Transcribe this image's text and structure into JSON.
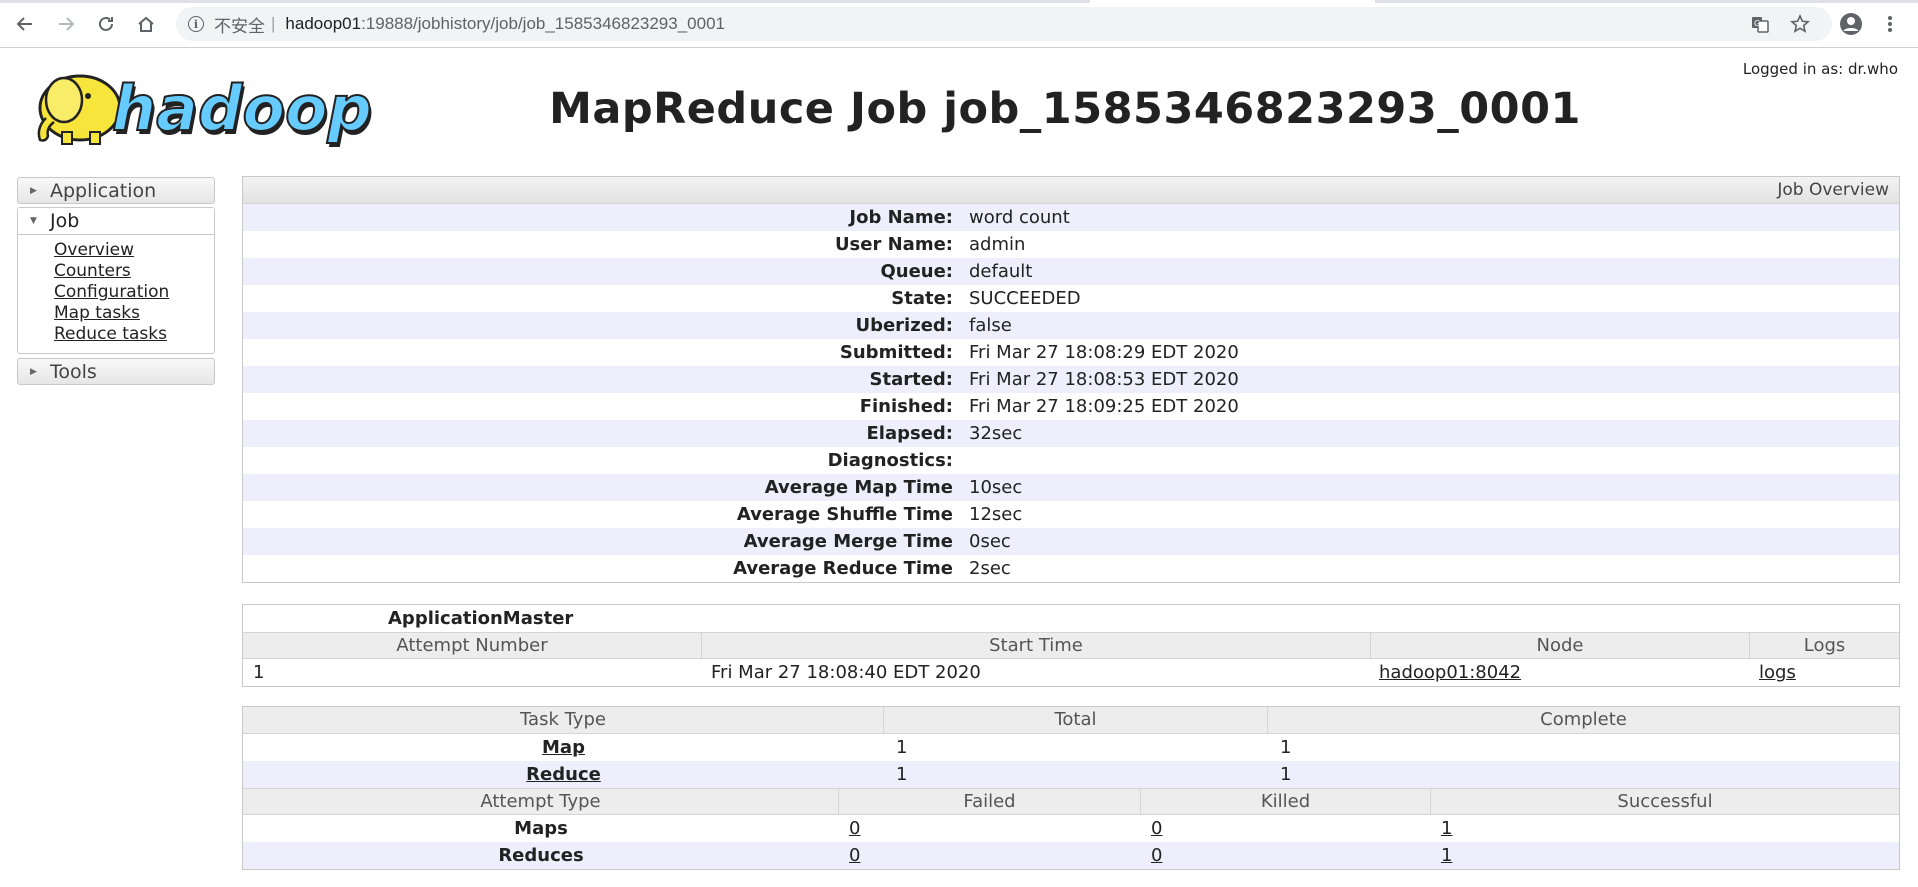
{
  "browser": {
    "insecure_label": "不安全",
    "url_host": "hadoop01",
    "url_path": ":19888/jobhistory/job/job_1585346823293_0001"
  },
  "header": {
    "logged_in": "Logged in as: dr.who",
    "title": "MapReduce Job job_1585346823293_0001",
    "logo_text": "hadoop"
  },
  "nav": {
    "application": "Application",
    "job": "Job",
    "job_items": [
      "Overview",
      "Counters",
      "Configuration",
      "Map tasks",
      "Reduce tasks"
    ],
    "tools": "Tools"
  },
  "overview": {
    "header": "Job Overview",
    "rows": [
      {
        "key": "Job Name:",
        "value": "word count"
      },
      {
        "key": "User Name:",
        "value": "admin"
      },
      {
        "key": "Queue:",
        "value": "default"
      },
      {
        "key": "State:",
        "value": "SUCCEEDED"
      },
      {
        "key": "Uberized:",
        "value": "false"
      },
      {
        "key": "Submitted:",
        "value": "Fri Mar 27 18:08:29 EDT 2020"
      },
      {
        "key": "Started:",
        "value": "Fri Mar 27 18:08:53 EDT 2020"
      },
      {
        "key": "Finished:",
        "value": "Fri Mar 27 18:09:25 EDT 2020"
      },
      {
        "key": "Elapsed:",
        "value": "32sec"
      },
      {
        "key": "Diagnostics:",
        "value": ""
      },
      {
        "key": "Average Map Time",
        "value": "10sec"
      },
      {
        "key": "Average Shuffle Time",
        "value": "12sec"
      },
      {
        "key": "Average Merge Time",
        "value": "0sec"
      },
      {
        "key": "Average Reduce Time",
        "value": "2sec"
      }
    ]
  },
  "app_master": {
    "title": "ApplicationMaster",
    "columns": [
      "Attempt Number",
      "Start Time",
      "Node",
      "Logs"
    ],
    "row": {
      "attempt": "1",
      "start": "Fri Mar 27 18:08:40 EDT 2020",
      "node": "hadoop01:8042",
      "logs": "logs"
    }
  },
  "tasks": {
    "columns": [
      "Task Type",
      "Total",
      "Complete"
    ],
    "rows": [
      {
        "type": "Map",
        "total": "1",
        "complete": "1"
      },
      {
        "type": "Reduce",
        "total": "1",
        "complete": "1"
      }
    ],
    "attempt_columns": [
      "Attempt Type",
      "Failed",
      "Killed",
      "Successful"
    ],
    "attempt_rows": [
      {
        "type": "Maps",
        "failed": "0",
        "killed": "0",
        "successful": "1"
      },
      {
        "type": "Reduces",
        "failed": "0",
        "killed": "0",
        "successful": "1"
      }
    ]
  }
}
